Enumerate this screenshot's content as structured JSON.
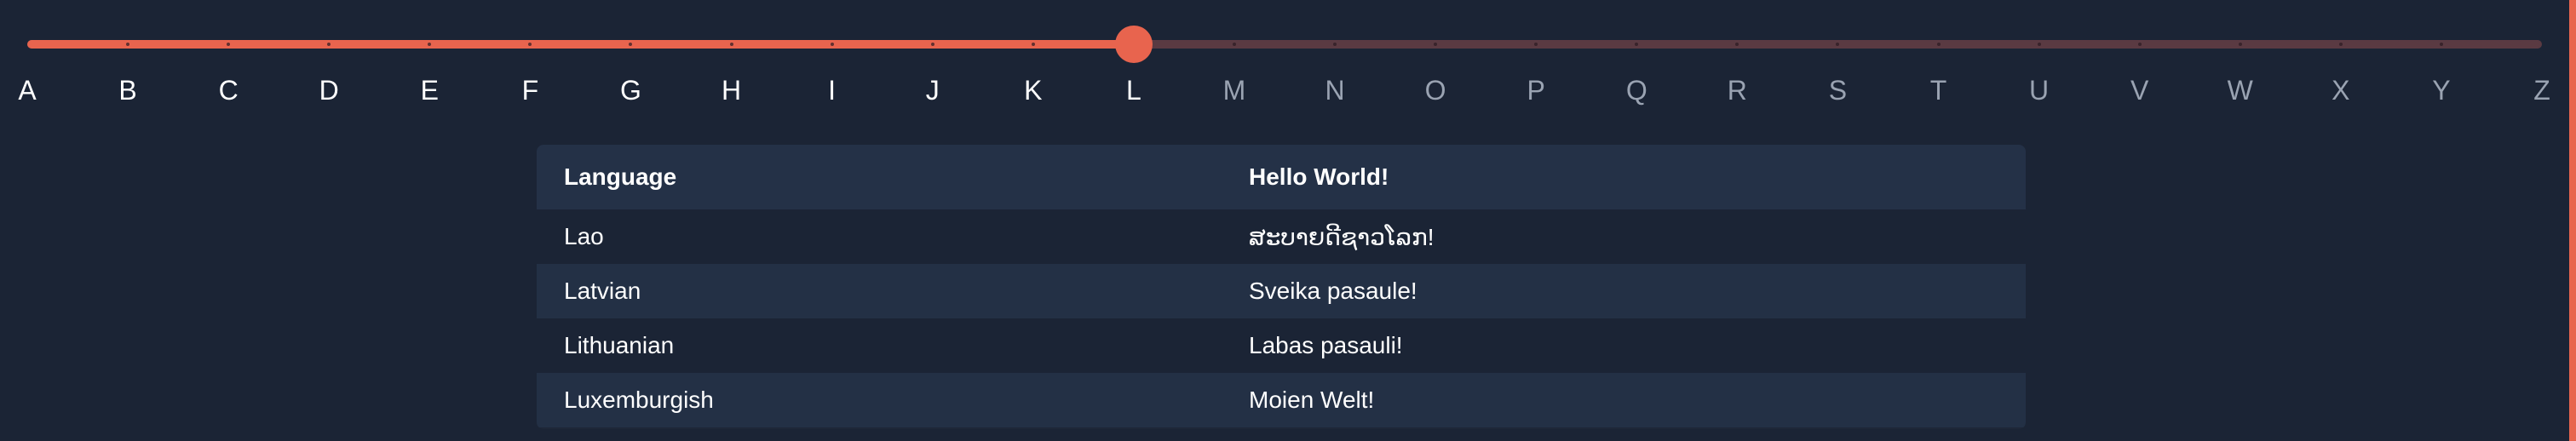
{
  "slider": {
    "letters": [
      "A",
      "B",
      "C",
      "D",
      "E",
      "F",
      "G",
      "H",
      "I",
      "J",
      "K",
      "L",
      "M",
      "N",
      "O",
      "P",
      "Q",
      "R",
      "S",
      "T",
      "U",
      "V",
      "W",
      "X",
      "Y",
      "Z"
    ],
    "selected_index": 11,
    "selected_letter": "L",
    "accent_color": "#e8644e",
    "track_color": "#5a3a42"
  },
  "table": {
    "headers": {
      "language": "Language",
      "hello": "Hello World!"
    },
    "rows": [
      {
        "language": "Lao",
        "hello": "ສະບາຍດີຊາວໂລກ!"
      },
      {
        "language": "Latvian",
        "hello": "Sveika pasaule!"
      },
      {
        "language": "Lithuanian",
        "hello": "Labas pasauli!"
      },
      {
        "language": "Luxemburgish",
        "hello": "Moien Welt!"
      }
    ]
  }
}
